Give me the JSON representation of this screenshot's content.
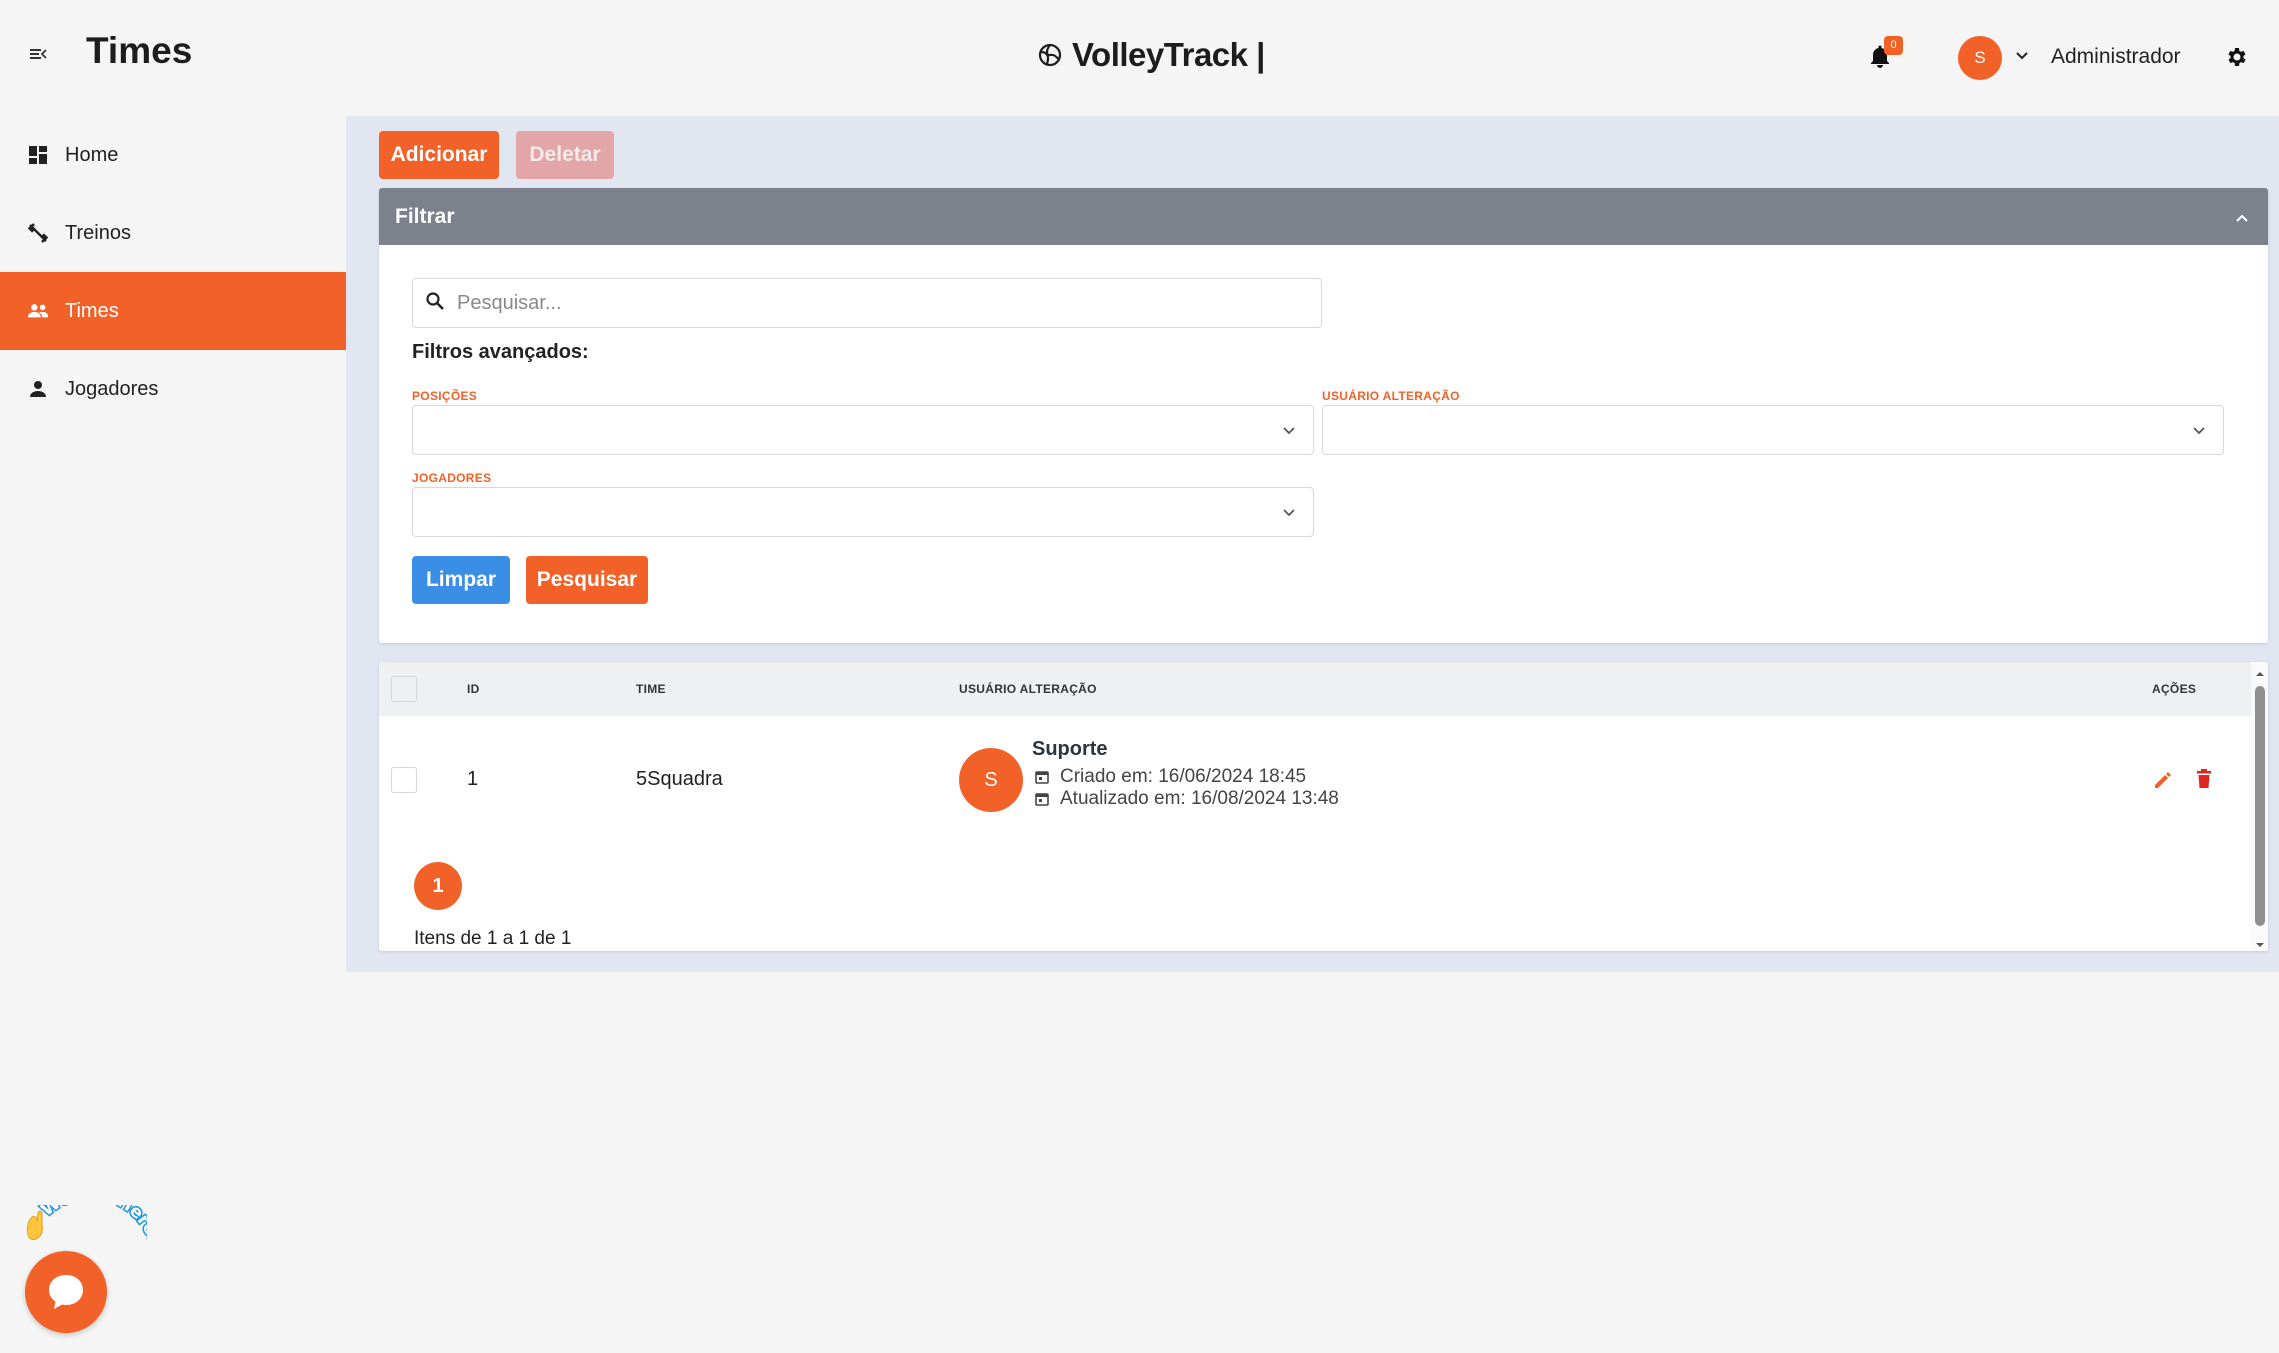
{
  "header": {
    "page_title": "Times",
    "brand": "VolleyTrack |",
    "notifications_count": "0",
    "avatar_initial": "S",
    "user_name": "Administrador"
  },
  "sidebar": {
    "items": [
      {
        "label": "Home",
        "icon": "dashboard-icon"
      },
      {
        "label": "Treinos",
        "icon": "fitness-icon"
      },
      {
        "label": "Times",
        "icon": "group-icon",
        "active": true
      },
      {
        "label": "Jogadores",
        "icon": "person-icon"
      }
    ]
  },
  "toolbar": {
    "add_label": "Adicionar",
    "delete_label": "Deletar"
  },
  "filter": {
    "title": "Filtrar",
    "search_placeholder": "Pesquisar...",
    "advanced_label": "Filtros avançados:",
    "positions_label": "POSIÇÕES",
    "user_change_label": "USUÁRIO ALTERAÇÃO",
    "players_label": "JOGADORES",
    "clear_label": "Limpar",
    "search_label": "Pesquisar"
  },
  "table": {
    "columns": {
      "id": "ID",
      "team": "TIME",
      "user_change": "USUÁRIO ALTERAÇÃO",
      "actions": "AÇÕES"
    },
    "rows": [
      {
        "id": "1",
        "team": "5Squadra",
        "avatar_initial": "S",
        "user": "Suporte",
        "created": "Criado em: 16/06/2024 18:45",
        "updated": "Atualizado em: 16/08/2024 13:48"
      }
    ],
    "page": "1",
    "items_info": "Itens de 1 a 1 de 1"
  },
  "chat_widget": {
    "text": "We Are Here!"
  },
  "colors": {
    "accent": "#f26127",
    "filter_header": "#7c818c",
    "main_bg": "#e2e6f1",
    "clear_button": "#3a8ee6",
    "delete_disabled": "#e2a5a8"
  }
}
